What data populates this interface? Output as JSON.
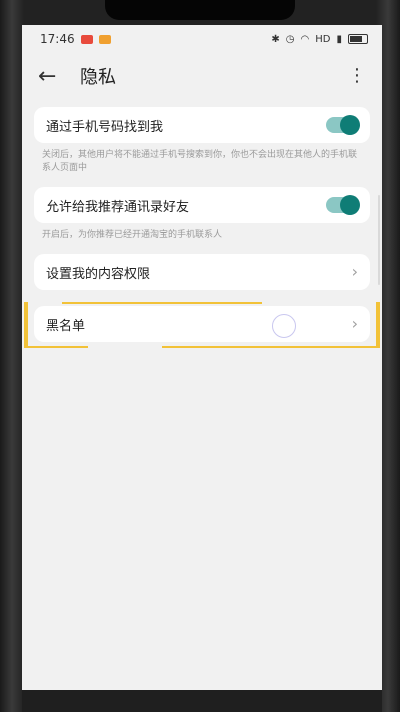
{
  "status_bar": {
    "time": "17:46",
    "network": "HD"
  },
  "app_bar": {
    "title": "隐私"
  },
  "settings": [
    {
      "label": "通过手机号码找到我",
      "type": "toggle",
      "on": true,
      "description": "关闭后，其他用户将不能通过手机号搜索到你，你也不会出现在其他人的手机联系人页面中"
    },
    {
      "label": "允许给我推荐通讯录好友",
      "type": "toggle",
      "on": true,
      "description": "开启后，为你推荐已经开通淘宝的手机联系人"
    },
    {
      "label": "设置我的内容权限",
      "type": "link"
    },
    {
      "label": "黑名单",
      "type": "link",
      "highlighted": true
    }
  ],
  "colors": {
    "toggle_track": "#8bc7c4",
    "toggle_knob": "#0f7d76",
    "highlight": "#f2c238",
    "background": "#f1f1f1"
  }
}
